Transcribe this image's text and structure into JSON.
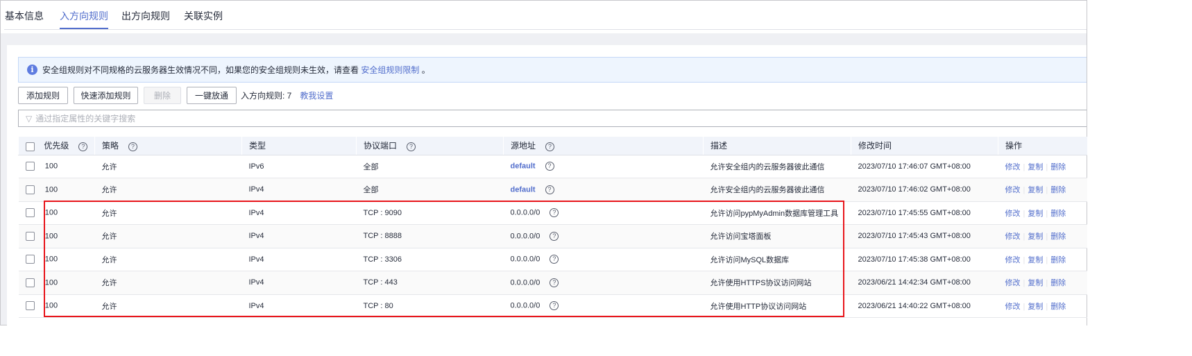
{
  "tabs": [
    "基本信息",
    "入方向规则",
    "出方向规则",
    "关联实例"
  ],
  "notice": {
    "text": "安全组规则对不同规格的云服务器生效情况不同，如果您的安全组规则未生效，请查看",
    "link": "安全组规则限制",
    "suffix": "。"
  },
  "toolbar": {
    "add": "添加规则",
    "quick_add": "快速添加规则",
    "delete": "删除",
    "one_click": "一键放通",
    "count_label": "入方向规则: 7",
    "help": "教我设置"
  },
  "search": {
    "placeholder": "通过指定属性的关键字搜索"
  },
  "columns": [
    "优先级",
    "策略",
    "类型",
    "协议端口",
    "源地址",
    "描述",
    "修改时间",
    "操作"
  ],
  "actions": [
    "修改",
    "复制",
    "删除"
  ],
  "rows": [
    {
      "priority": "100",
      "policy": "允许",
      "type": "IPv6",
      "port": "全部",
      "source": "default",
      "desc": "允许安全组内的云服务器彼此通信",
      "time": "2023/07/10 17:46:07 GMT+08:00"
    },
    {
      "priority": "100",
      "policy": "允许",
      "type": "IPv4",
      "port": "全部",
      "source": "default",
      "desc": "允许安全组内的云服务器彼此通信",
      "time": "2023/07/10 17:46:02 GMT+08:00"
    },
    {
      "priority": "100",
      "policy": "允许",
      "type": "IPv4",
      "port": "TCP : 9090",
      "source": "0.0.0.0/0",
      "desc": "允许访问pypMyAdmin数据库管理工具",
      "time": "2023/07/10 17:45:55 GMT+08:00"
    },
    {
      "priority": "100",
      "policy": "允许",
      "type": "IPv4",
      "port": "TCP : 8888",
      "source": "0.0.0.0/0",
      "desc": "允许访问宝塔面板",
      "time": "2023/07/10 17:45:43 GMT+08:00"
    },
    {
      "priority": "100",
      "policy": "允许",
      "type": "IPv4",
      "port": "TCP : 3306",
      "source": "0.0.0.0/0",
      "desc": "允许访问MySQL数据库",
      "time": "2023/07/10 17:45:38 GMT+08:00"
    },
    {
      "priority": "100",
      "policy": "允许",
      "type": "IPv4",
      "port": "TCP : 443",
      "source": "0.0.0.0/0",
      "desc": "允许使用HTTPS协议访问网站",
      "time": "2023/06/21 14:42:34 GMT+08:00"
    },
    {
      "priority": "100",
      "policy": "允许",
      "type": "IPv4",
      "port": "TCP : 80",
      "source": "0.0.0.0/0",
      "desc": "允许使用HTTP协议访问网站",
      "time": "2023/06/21 14:40:22 GMT+08:00"
    }
  ]
}
